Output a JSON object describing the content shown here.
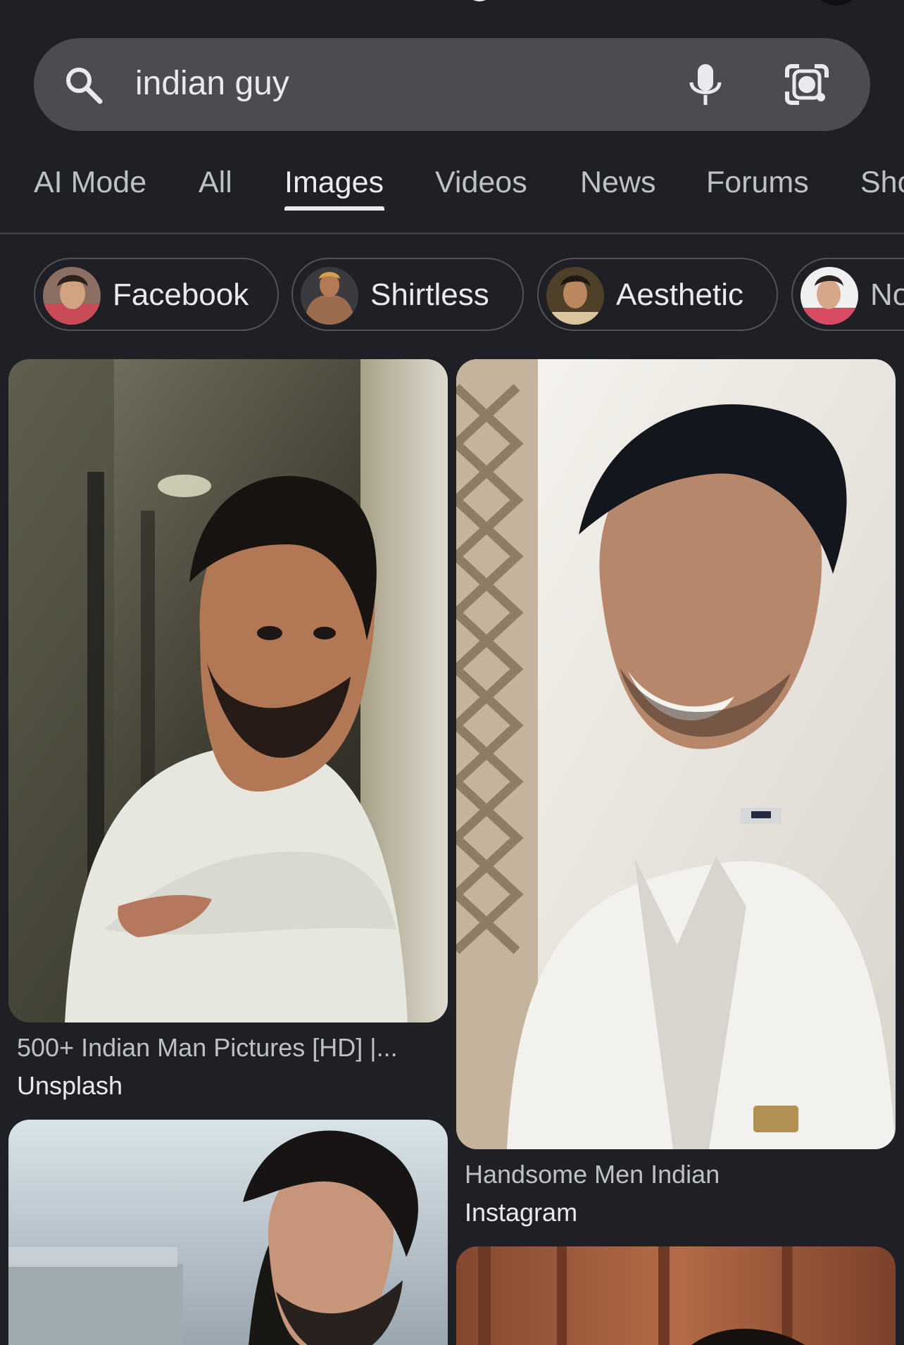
{
  "search": {
    "query": "indian guy"
  },
  "tabs": [
    {
      "label": "AI Mode"
    },
    {
      "label": "All"
    },
    {
      "label": "Images"
    },
    {
      "label": "Videos"
    },
    {
      "label": "News"
    },
    {
      "label": "Forums"
    },
    {
      "label": "Sho"
    }
  ],
  "active_tab": "Images",
  "chips": [
    {
      "label": "Facebook"
    },
    {
      "label": "Shirtless"
    },
    {
      "label": "Aesthetic"
    },
    {
      "label": "No"
    }
  ],
  "results": [
    {
      "title": "500+ Indian Man Pictures [HD] |...",
      "source": "Unsplash"
    },
    {
      "title": "Handsome Men Indian",
      "source": "Instagram"
    }
  ],
  "colors": {
    "background": "#1f2025",
    "search_bar": "#4a4c52",
    "text_primary": "#e8eaed",
    "text_secondary": "#bdc1c6"
  }
}
